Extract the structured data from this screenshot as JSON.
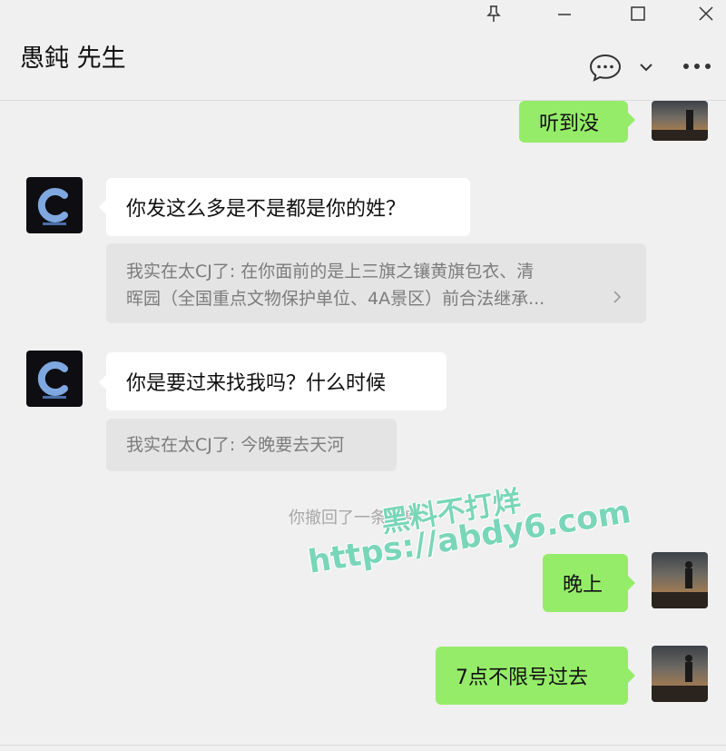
{
  "window": {
    "title": "愚鈍 先生",
    "controls": [
      "pin-icon",
      "minimize-icon",
      "maximize-icon",
      "close-icon"
    ]
  },
  "header_actions": [
    "chat-bubble-icon",
    "chevron-down-icon",
    "more-icon"
  ],
  "messages": {
    "m1": {
      "text": "听到没"
    },
    "m2": {
      "text": "你发这么多是不是都是你的姓？",
      "quote_line1": "我实在太CJ了: 在你面前的是上三旗之镶黄旗包衣、清",
      "quote_line2": "晖园（全国重点文物保护单位、4A景区）前合法继承..."
    },
    "m3": {
      "text": "你是要过来找我吗？什么时候",
      "quote_line1": "我实在太CJ了: 今晚要去天河"
    },
    "recall": "你撤回了一条消息",
    "m4": {
      "text": "晚上"
    },
    "m5": {
      "text": "7点不限号过去"
    }
  },
  "watermark": {
    "line1": "黑料不打烊",
    "line2": "https://abdy6.com"
  },
  "colors": {
    "background": "#f0f0f0",
    "outgoing_bubble": "#95ec69",
    "incoming_bubble": "#ffffff",
    "quote_background": "#e4e4e4",
    "watermark": "#7ad6b8"
  }
}
